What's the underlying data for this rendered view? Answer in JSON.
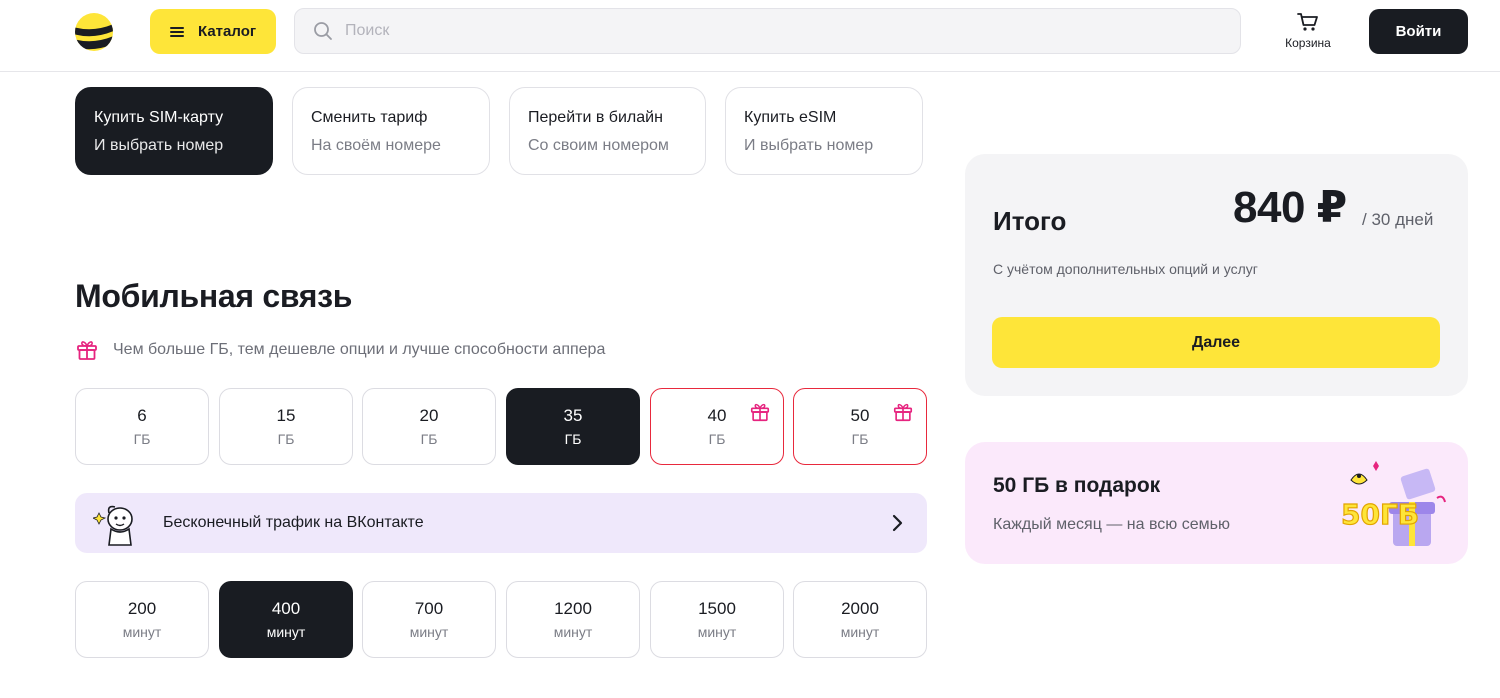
{
  "header": {
    "catalog_label": "Каталог",
    "search_placeholder": "Поиск",
    "cart_label": "Корзина",
    "login_label": "Войти"
  },
  "modes": [
    {
      "title": "Купить SIM-карту",
      "subtitle": "И выбрать номер",
      "active": true
    },
    {
      "title": "Сменить тариф",
      "subtitle": "На своём номере",
      "active": false
    },
    {
      "title": "Перейти в билайн",
      "subtitle": "Со своим номером",
      "active": false
    },
    {
      "title": "Купить eSIM",
      "subtitle": "И выбрать номер",
      "active": false
    }
  ],
  "section": {
    "title": "Мобильная связь",
    "promo_text": "Чем больше ГБ, тем дешевле опции и лучше способности аппера"
  },
  "data_options": [
    {
      "value": "6",
      "unit": "ГБ",
      "active": false,
      "gift": false
    },
    {
      "value": "15",
      "unit": "ГБ",
      "active": false,
      "gift": false
    },
    {
      "value": "20",
      "unit": "ГБ",
      "active": false,
      "gift": false
    },
    {
      "value": "35",
      "unit": "ГБ",
      "active": true,
      "gift": false
    },
    {
      "value": "40",
      "unit": "ГБ",
      "active": false,
      "gift": true
    },
    {
      "value": "50",
      "unit": "ГБ",
      "active": false,
      "gift": true
    }
  ],
  "vk_banner": {
    "text": "Бесконечный трафик на ВКонтакте"
  },
  "minute_options": [
    {
      "value": "200",
      "unit": "минут",
      "active": false
    },
    {
      "value": "400",
      "unit": "минут",
      "active": true
    },
    {
      "value": "700",
      "unit": "минут",
      "active": false
    },
    {
      "value": "1200",
      "unit": "минут",
      "active": false
    },
    {
      "value": "1500",
      "unit": "минут",
      "active": false
    },
    {
      "value": "2000",
      "unit": "минут",
      "active": false
    }
  ],
  "total": {
    "label": "Итого",
    "price": "840 ₽",
    "period": "/ 30 дней",
    "note": "С учётом дополнительных опций и услуг",
    "next_label": "Далее"
  },
  "gift_promo": {
    "title": "50 ГБ в подарок",
    "subtitle": "Каждый месяц — на всю семью",
    "art_text": "50ГБ"
  },
  "colors": {
    "brand_yellow": "#fee539",
    "dark": "#191c22",
    "gift_red": "#e8293d",
    "gift_pink": "#e6247f",
    "vk_banner_bg": "#efe8fb",
    "promo_bg": "#fbe9fb"
  }
}
